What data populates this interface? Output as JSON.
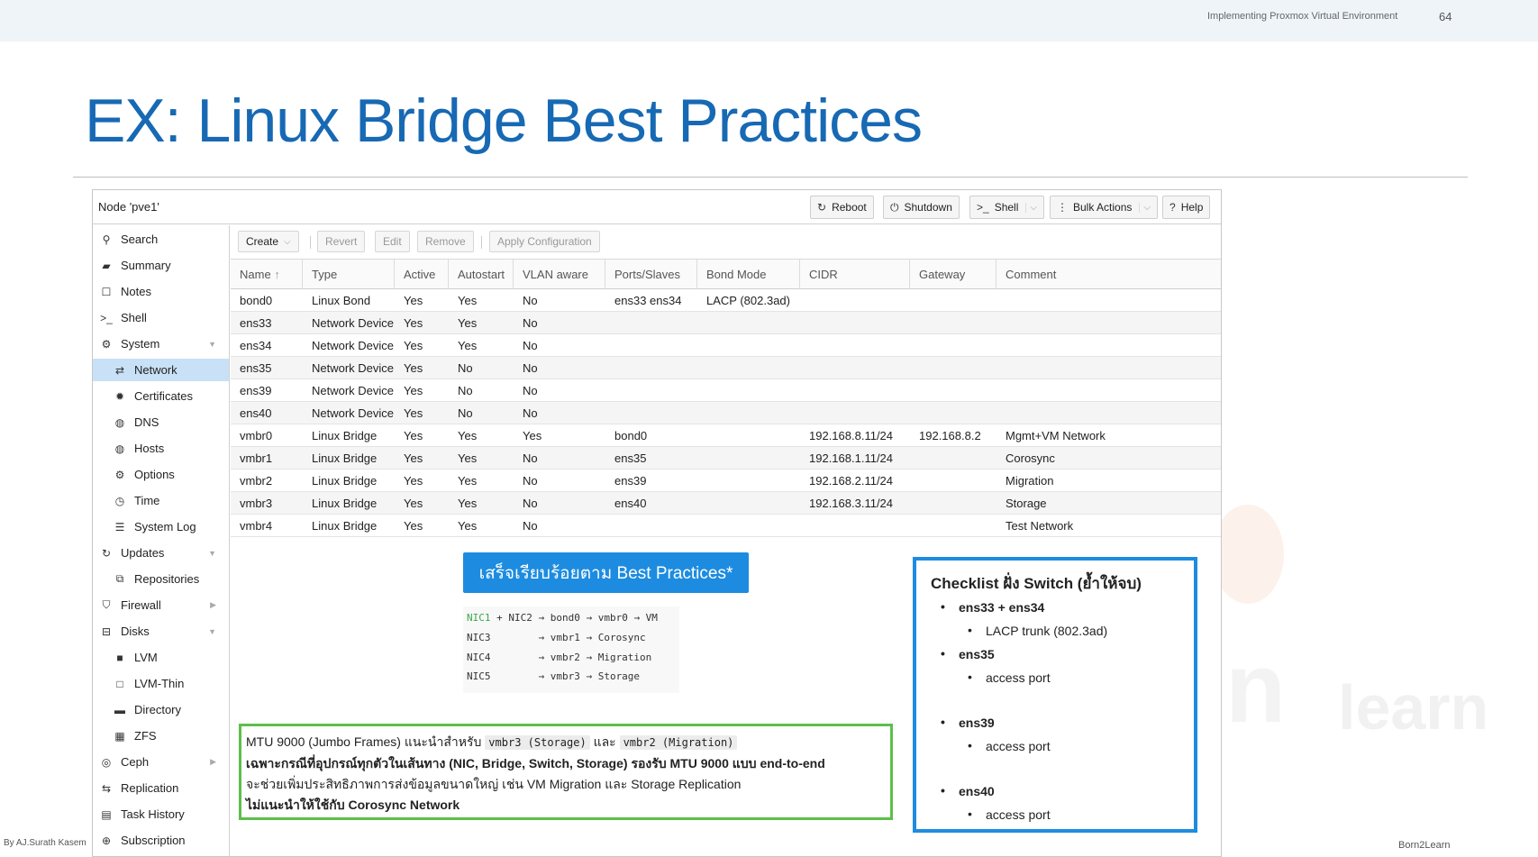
{
  "slide": {
    "course": "Implementing Proxmox Virtual Environment",
    "page_number": "64",
    "title": "EX: Linux Bridge Best Practices",
    "footer_left": "By AJ.Surath Kasem",
    "footer_right": "Born2Learn",
    "watermark": "learn"
  },
  "pve": {
    "node_title": "Node 'pve1'",
    "header_buttons": {
      "reboot": "Reboot",
      "shutdown": "Shutdown",
      "shell": "Shell",
      "bulk_actions": "Bulk Actions",
      "help": "Help"
    },
    "nav": {
      "search": "Search",
      "summary": "Summary",
      "notes": "Notes",
      "shell": "Shell",
      "system": "System",
      "network": "Network",
      "certificates": "Certificates",
      "dns": "DNS",
      "hosts": "Hosts",
      "options": "Options",
      "time": "Time",
      "system_log": "System Log",
      "updates": "Updates",
      "repositories": "Repositories",
      "firewall": "Firewall",
      "disks": "Disks",
      "lvm": "LVM",
      "lvm_thin": "LVM-Thin",
      "directory": "Directory",
      "zfs": "ZFS",
      "ceph": "Ceph",
      "replication": "Replication",
      "task_history": "Task History",
      "subscription": "Subscription"
    },
    "toolbar": {
      "create": "Create",
      "revert": "Revert",
      "edit": "Edit",
      "remove": "Remove",
      "apply": "Apply Configuration"
    },
    "columns": {
      "name": "Name",
      "type": "Type",
      "active": "Active",
      "autostart": "Autostart",
      "vlan": "VLAN aware",
      "ports": "Ports/Slaves",
      "bond_mode": "Bond Mode",
      "cidr": "CIDR",
      "gateway": "Gateway",
      "comment": "Comment"
    },
    "rows": [
      {
        "name": "bond0",
        "type": "Linux Bond",
        "active": "Yes",
        "autostart": "Yes",
        "vlan": "No",
        "ports": "ens33 ens34",
        "bond_mode": "LACP (802.3ad)",
        "cidr": "",
        "gateway": "",
        "comment": ""
      },
      {
        "name": "ens33",
        "type": "Network Device",
        "active": "Yes",
        "autostart": "Yes",
        "vlan": "No",
        "ports": "",
        "bond_mode": "",
        "cidr": "",
        "gateway": "",
        "comment": ""
      },
      {
        "name": "ens34",
        "type": "Network Device",
        "active": "Yes",
        "autostart": "Yes",
        "vlan": "No",
        "ports": "",
        "bond_mode": "",
        "cidr": "",
        "gateway": "",
        "comment": ""
      },
      {
        "name": "ens35",
        "type": "Network Device",
        "active": "Yes",
        "autostart": "No",
        "vlan": "No",
        "ports": "",
        "bond_mode": "",
        "cidr": "",
        "gateway": "",
        "comment": ""
      },
      {
        "name": "ens39",
        "type": "Network Device",
        "active": "Yes",
        "autostart": "No",
        "vlan": "No",
        "ports": "",
        "bond_mode": "",
        "cidr": "",
        "gateway": "",
        "comment": ""
      },
      {
        "name": "ens40",
        "type": "Network Device",
        "active": "Yes",
        "autostart": "No",
        "vlan": "No",
        "ports": "",
        "bond_mode": "",
        "cidr": "",
        "gateway": "",
        "comment": ""
      },
      {
        "name": "vmbr0",
        "type": "Linux Bridge",
        "active": "Yes",
        "autostart": "Yes",
        "vlan": "Yes",
        "ports": "bond0",
        "bond_mode": "",
        "cidr": "192.168.8.11/24",
        "gateway": "192.168.8.2",
        "comment": "Mgmt+VM Network"
      },
      {
        "name": "vmbr1",
        "type": "Linux Bridge",
        "active": "Yes",
        "autostart": "Yes",
        "vlan": "No",
        "ports": "ens35",
        "bond_mode": "",
        "cidr": "192.168.1.11/24",
        "gateway": "",
        "comment": "Corosync"
      },
      {
        "name": "vmbr2",
        "type": "Linux Bridge",
        "active": "Yes",
        "autostart": "Yes",
        "vlan": "No",
        "ports": "ens39",
        "bond_mode": "",
        "cidr": "192.168.2.11/24",
        "gateway": "",
        "comment": "Migration"
      },
      {
        "name": "vmbr3",
        "type": "Linux Bridge",
        "active": "Yes",
        "autostart": "Yes",
        "vlan": "No",
        "ports": "ens40",
        "bond_mode": "",
        "cidr": "192.168.3.11/24",
        "gateway": "",
        "comment": "Storage"
      },
      {
        "name": "vmbr4",
        "type": "Linux Bridge",
        "active": "Yes",
        "autostart": "Yes",
        "vlan": "No",
        "ports": "",
        "bond_mode": "",
        "cidr": "",
        "gateway": "",
        "comment": "Test Network"
      }
    ]
  },
  "annotations": {
    "banner": "เสร็จเรียบร้อยตาม Best Practices*",
    "flow": {
      "l1_nic": "NIC1",
      "l1_rest": " + NIC2 → bond0 → vmbr0 → VM",
      "l2": "NIC3        → vmbr1 → Corosync",
      "l3": "NIC4        → vmbr2 → Migration",
      "l4": "NIC5        → vmbr3 → Storage"
    },
    "mtu": {
      "l1_text": "MTU 9000 (Jumbo Frames) แนะนำสำหรับ",
      "code1": "vmbr3 (Storage)",
      "l1_and": "และ",
      "code2": "vmbr2 (Migration)",
      "l2": "เฉพาะกรณีที่อุปกรณ์ทุกตัวในเส้นทาง (NIC, Bridge, Switch, Storage) รองรับ MTU 9000 แบบ end-to-end",
      "l3": "จะช่วยเพิ่มประสิทธิภาพการส่งข้อมูลขนาดใหญ่ เช่น VM Migration และ Storage Replication",
      "l4": "ไม่แนะนำให้ใช้กับ Corosync Network"
    },
    "checklist": {
      "title": "Checklist ฝั่ง Switch (ย้ำให้จบ)",
      "i1": "ens33 + ens34",
      "i1a": "LACP trunk (802.3ad)",
      "i2": "ens35",
      "i2a": "access port",
      "i3": "ens39",
      "i3a": "access port",
      "i4": "ens40",
      "i4a": "access port"
    }
  }
}
